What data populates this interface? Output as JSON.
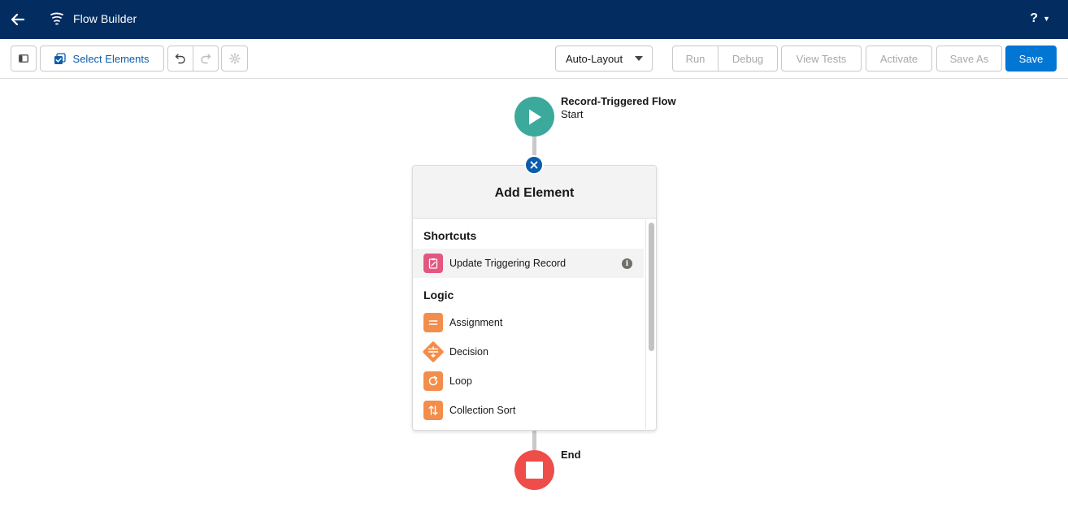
{
  "header": {
    "title": "Flow Builder",
    "help_label": "?"
  },
  "toolbar": {
    "select_elements_label": "Select Elements",
    "layout_value": "Auto-Layout",
    "run_label": "Run",
    "debug_label": "Debug",
    "view_tests_label": "View Tests",
    "activate_label": "Activate",
    "save_as_label": "Save As",
    "save_label": "Save"
  },
  "canvas": {
    "start": {
      "title": "Record-Triggered Flow",
      "subtitle": "Start"
    },
    "end": {
      "label": "End"
    }
  },
  "add_element": {
    "title": "Add Element",
    "sections": [
      {
        "title": "Shortcuts",
        "items": [
          {
            "label": "Update Triggering Record",
            "icon": "update-record-icon",
            "color": "#e3567f"
          }
        ]
      },
      {
        "title": "Logic",
        "items": [
          {
            "label": "Assignment",
            "icon": "assignment-icon",
            "color": "#f38d4c"
          },
          {
            "label": "Decision",
            "icon": "decision-icon",
            "color": "#f38d4c"
          },
          {
            "label": "Loop",
            "icon": "loop-icon",
            "color": "#f38d4c"
          },
          {
            "label": "Collection Sort",
            "icon": "collection-sort-icon",
            "color": "#f38d4c"
          }
        ]
      }
    ]
  },
  "colors": {
    "header_bg": "#032d60",
    "brand_blue": "#0176d3",
    "start_node": "#3ba99c",
    "end_node": "#ef4d49",
    "logic_orange": "#f38d4c",
    "shortcut_pink": "#e3567f"
  }
}
